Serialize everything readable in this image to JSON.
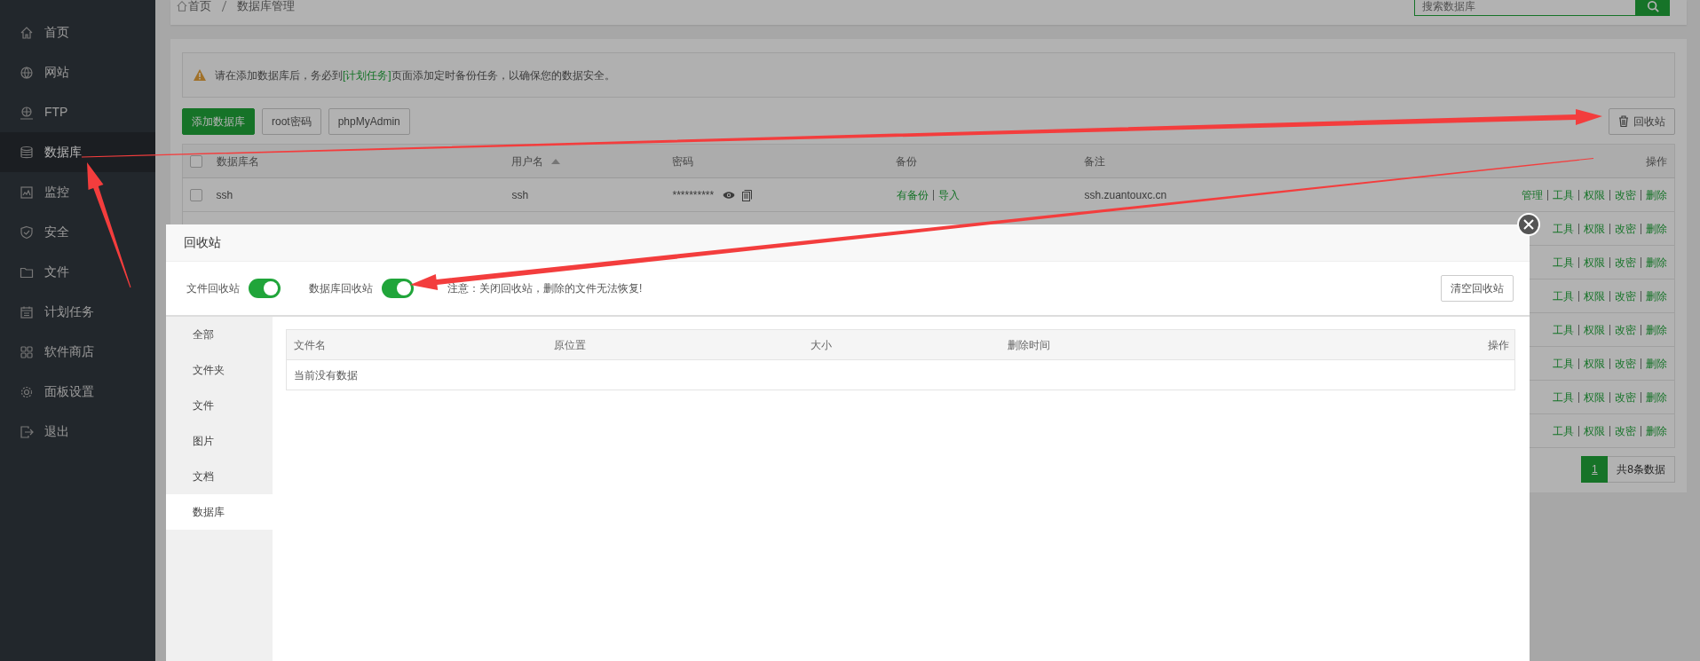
{
  "sidebar": {
    "items": [
      {
        "label": "首页",
        "selected": false
      },
      {
        "label": "网站",
        "selected": false
      },
      {
        "label": "FTP",
        "selected": false
      },
      {
        "label": "数据库",
        "selected": true
      },
      {
        "label": "监控",
        "selected": false
      },
      {
        "label": "安全",
        "selected": false
      },
      {
        "label": "文件",
        "selected": false
      },
      {
        "label": "计划任务",
        "selected": false
      },
      {
        "label": "软件商店",
        "selected": false
      },
      {
        "label": "面板设置",
        "selected": false
      },
      {
        "label": "退出",
        "selected": false
      }
    ]
  },
  "breadcrumb": [
    "首页",
    "数据库管理"
  ],
  "search": {
    "placeholder": "搜索数据库"
  },
  "alert": {
    "before": "请在添加数据库后，务必到",
    "link": "[计划任务]",
    "after": "页面添加定时备份任务，以确保您的数据安全。"
  },
  "toolbar": {
    "buttons": [
      "添加数据库",
      "root密码",
      "phpMyAdmin"
    ],
    "recycle_button": "回收站"
  },
  "table": {
    "select_all_checked": false,
    "columns": [
      "数据库名",
      "用户名",
      "密码",
      "备份",
      "备注",
      "操作"
    ],
    "rows": [
      {
        "checked": false,
        "name": "ssh",
        "user": "ssh",
        "password": "**********",
        "backup": "有备份",
        "import": "导入",
        "note": "ssh.zuantouxc.cn",
        "actions": [
          "管理",
          "工具",
          "权限",
          "改密",
          "删除"
        ]
      },
      {
        "actions": [
          "工具",
          "权限",
          "改密",
          "删除"
        ]
      },
      {
        "actions": [
          "工具",
          "权限",
          "改密",
          "删除"
        ]
      },
      {
        "actions": [
          "工具",
          "权限",
          "改密",
          "删除"
        ]
      },
      {
        "actions": [
          "工具",
          "权限",
          "改密",
          "删除"
        ]
      },
      {
        "actions": [
          "工具",
          "权限",
          "改密",
          "删除"
        ]
      },
      {
        "actions": [
          "工具",
          "权限",
          "改密",
          "删除"
        ]
      },
      {
        "actions": [
          "工具",
          "权限",
          "改密",
          "删除"
        ]
      }
    ]
  },
  "pagination": {
    "pages": [
      {
        "label": "1",
        "selected": true
      }
    ],
    "total": "共8条数据"
  },
  "modal": {
    "title": "回收站",
    "switches": [
      {
        "label": "文件回收站",
        "on": true
      },
      {
        "label": "数据库回收站",
        "on": true
      }
    ],
    "notice": "注意：关闭回收站，删除的文件无法恢复!",
    "clear_button": "清空回收站",
    "tabs": [
      {
        "label": "全部",
        "selected": false
      },
      {
        "label": "文件夹",
        "selected": false
      },
      {
        "label": "文件",
        "selected": false
      },
      {
        "label": "图片",
        "selected": false
      },
      {
        "label": "文档",
        "selected": false
      },
      {
        "label": "数据库",
        "selected": true
      }
    ],
    "table": {
      "columns": [
        "文件名",
        "原位置",
        "大小",
        "删除时间",
        "操作"
      ],
      "empty": "当前没有数据"
    }
  }
}
